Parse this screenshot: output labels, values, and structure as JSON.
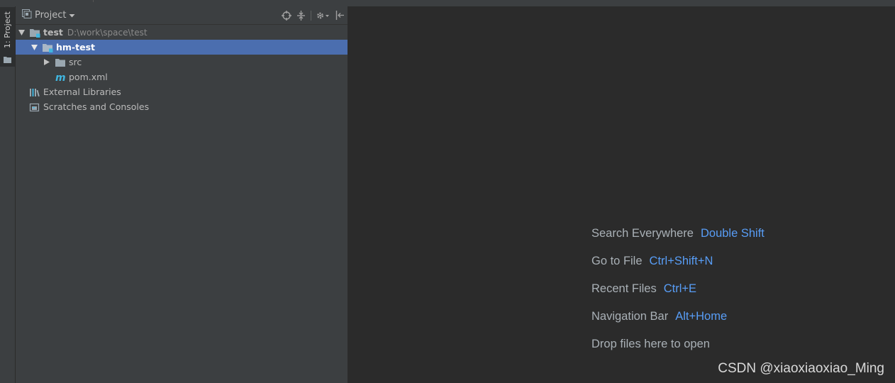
{
  "left_strip": {
    "tab_label": "1: Project"
  },
  "project_panel": {
    "title": "Project",
    "tools": [
      "locate-icon",
      "collapse-icon",
      "gear-icon",
      "hide-icon"
    ],
    "tree": {
      "root": {
        "name": "test",
        "path": "D:\\work\\space\\test"
      },
      "module": {
        "name": "hm-test"
      },
      "src": {
        "name": "src"
      },
      "pom": {
        "name": "pom.xml"
      },
      "libraries": {
        "name": "External Libraries"
      },
      "scratches": {
        "name": "Scratches and Consoles"
      }
    }
  },
  "editor": {
    "hints": [
      {
        "label": "Search Everywhere",
        "shortcut": "Double Shift"
      },
      {
        "label": "Go to File",
        "shortcut": "Ctrl+Shift+N"
      },
      {
        "label": "Recent Files",
        "shortcut": "Ctrl+E"
      },
      {
        "label": "Navigation Bar",
        "shortcut": "Alt+Home"
      },
      {
        "label": "Drop files here to open",
        "shortcut": ""
      }
    ],
    "watermark": "CSDN @xiaoxiaoxiao_Ming"
  },
  "colors": {
    "selection": "#4b6eaf",
    "shortcut": "#589df6",
    "panel_bg": "#3c3f41",
    "editor_bg": "#2b2b2b"
  }
}
